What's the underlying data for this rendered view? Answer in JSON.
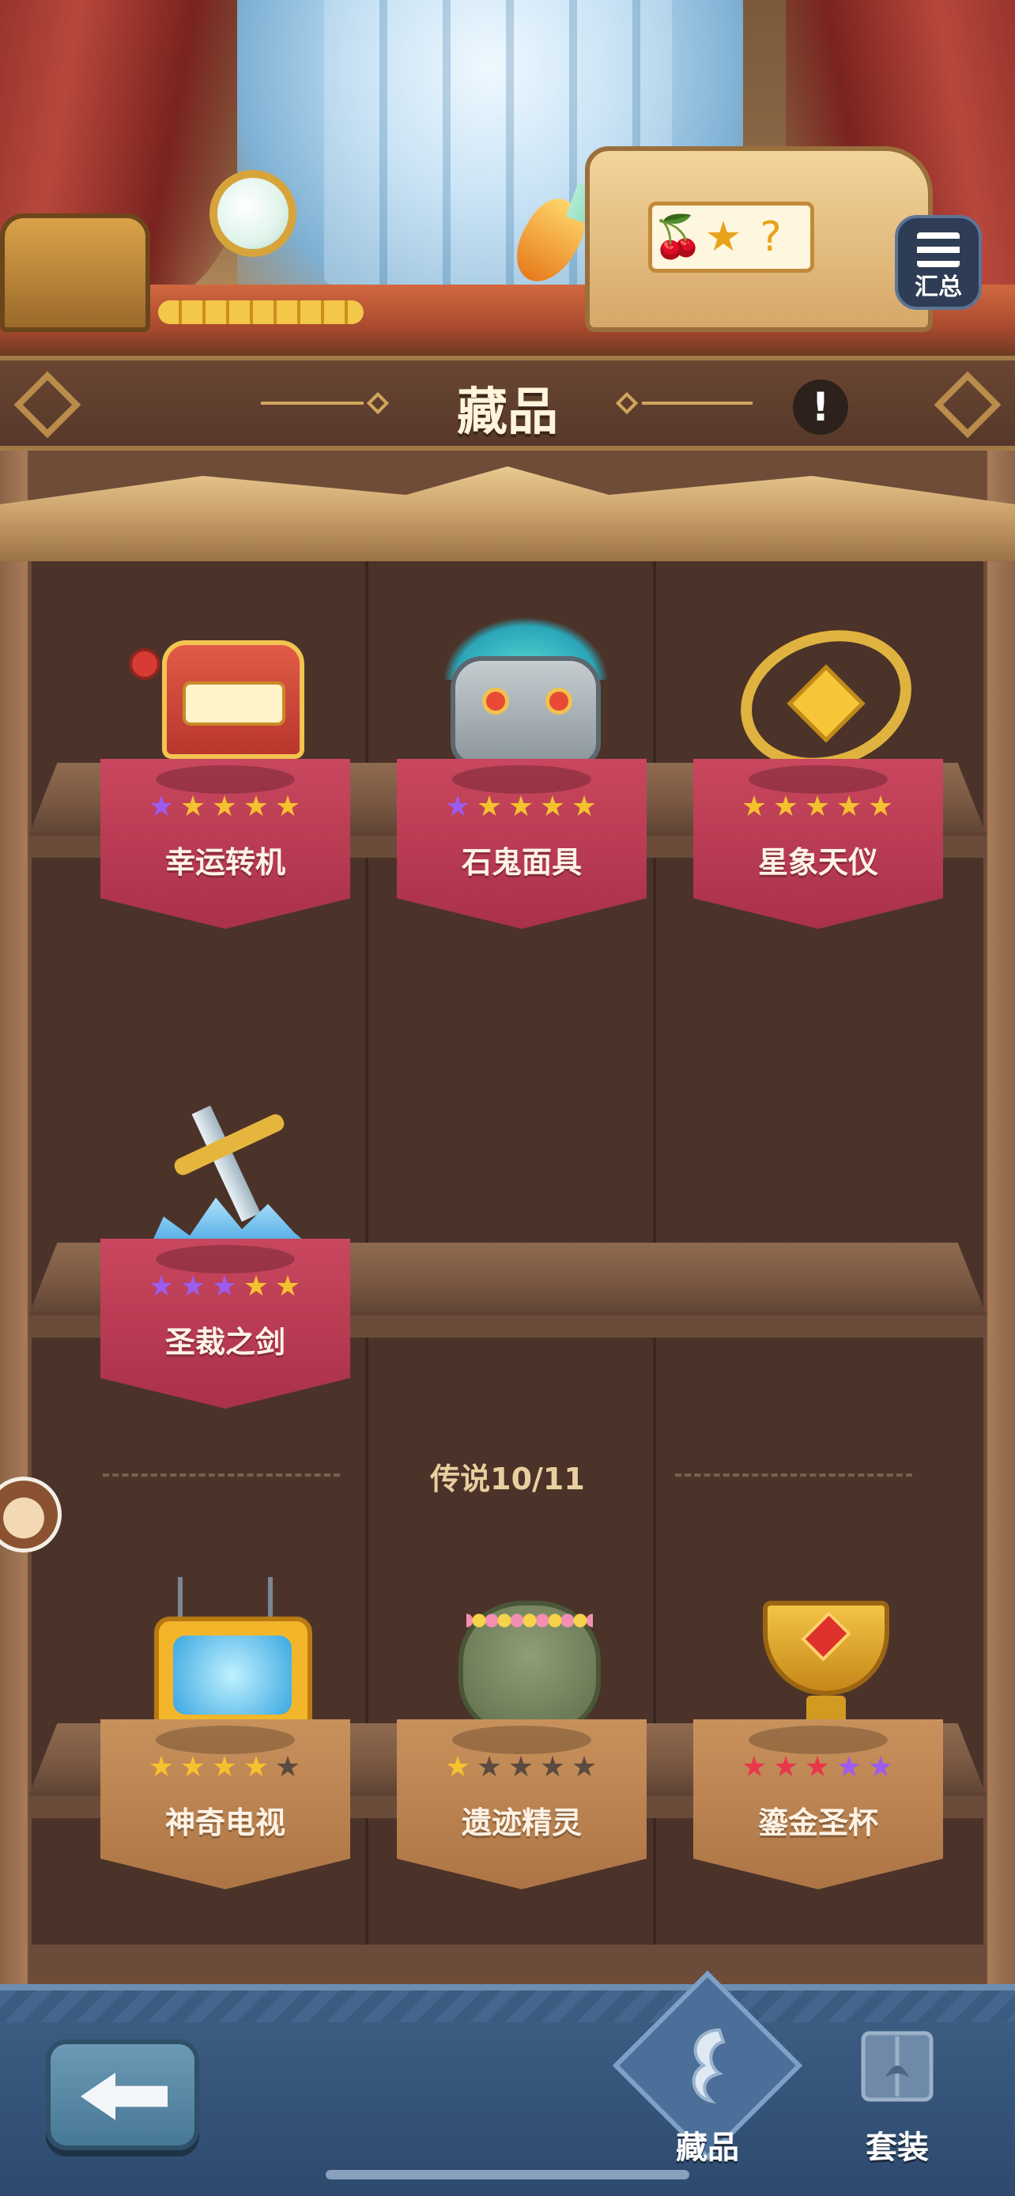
{
  "header": {
    "title": "藏品",
    "info_label": "!",
    "summary_label": "汇总"
  },
  "slot_symbols": [
    "🍒",
    "★",
    "?"
  ],
  "items_row1": [
    {
      "name": "幸运转机",
      "stars": [
        "purple",
        "gold",
        "gold",
        "gold",
        "gold"
      ],
      "card": "red",
      "icon": "slot-machine-icon"
    },
    {
      "name": "石鬼面具",
      "stars": [
        "purple",
        "gold",
        "gold",
        "gold",
        "gold"
      ],
      "card": "red",
      "icon": "stone-mask-icon"
    },
    {
      "name": "星象天仪",
      "stars": [
        "gold",
        "gold",
        "gold",
        "gold",
        "gold"
      ],
      "card": "red",
      "icon": "astrolabe-icon"
    }
  ],
  "items_row2": [
    {
      "name": "圣裁之剑",
      "stars": [
        "purple",
        "purple",
        "purple",
        "gold",
        "gold"
      ],
      "card": "red",
      "icon": "ice-sword-icon"
    }
  ],
  "legend_section": {
    "label": "传说10/11"
  },
  "items_row3": [
    {
      "name": "神奇电视",
      "stars": [
        "gold",
        "gold",
        "gold",
        "gold",
        "gray"
      ],
      "card": "tan",
      "icon": "magic-tv-icon"
    },
    {
      "name": "遗迹精灵",
      "stars": [
        "gold",
        "gray",
        "gray",
        "gray",
        "gray"
      ],
      "card": "tan",
      "icon": "ruin-spirit-icon"
    },
    {
      "name": "鎏金圣杯",
      "stars": [
        "red",
        "red",
        "red",
        "purple",
        "purple"
      ],
      "card": "tan",
      "icon": "golden-grail-icon"
    }
  ],
  "star_colors": {
    "gold": "#f6c12f",
    "purple": "#9b5cf0",
    "gray": "#5b4a40",
    "red": "#e8374b"
  },
  "bottom_nav": {
    "tabs": [
      {
        "label": "藏品",
        "active": true,
        "icon": "collection-harp-icon"
      },
      {
        "label": "套装",
        "active": false,
        "icon": "set-book-icon"
      }
    ]
  }
}
